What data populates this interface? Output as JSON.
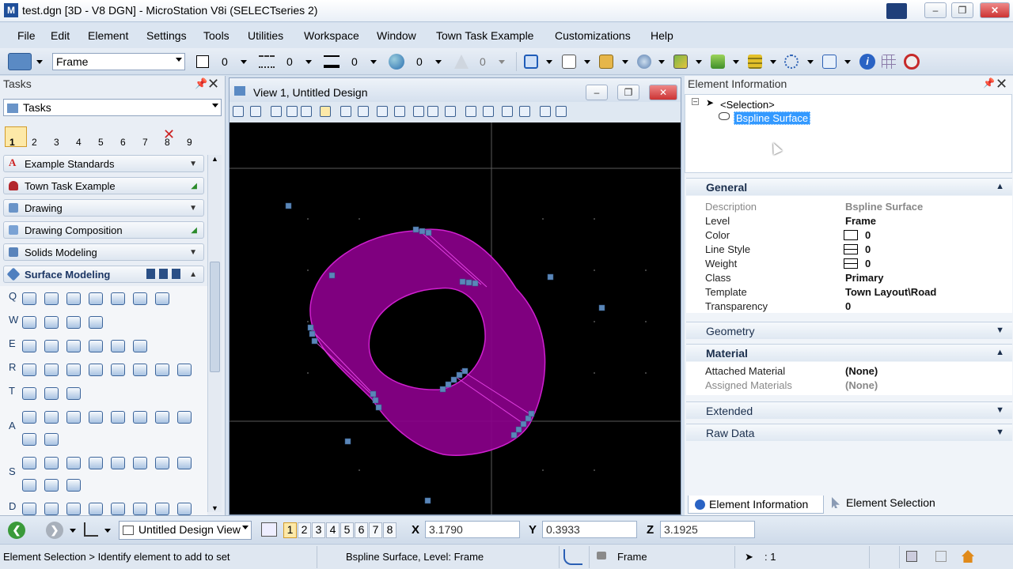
{
  "window": {
    "title": "test.dgn [3D - V8 DGN] - MicroStation V8i (SELECTseries 2)",
    "logo": "M"
  },
  "menu": [
    "File",
    "Edit",
    "Element",
    "Settings",
    "Tools",
    "Utilities",
    "Workspace",
    "Window",
    "Town Task Example",
    "Customizations",
    "Help"
  ],
  "attributes": {
    "level": "Frame",
    "color": "0",
    "style": "0",
    "weight": "0",
    "transparency": "0",
    "priority": "0"
  },
  "tasks": {
    "title": "Tasks",
    "selector": "Tasks",
    "tool_numbers": [
      "1",
      "2",
      "3",
      "4",
      "5",
      "6",
      "7",
      "8",
      "9"
    ],
    "sections": [
      {
        "label": "Example Standards"
      },
      {
        "label": "Town Task Example"
      },
      {
        "label": "Drawing"
      },
      {
        "label": "Drawing Composition"
      },
      {
        "label": "Solids Modeling"
      },
      {
        "label": "Surface Modeling"
      }
    ],
    "row_letters": [
      "Q",
      "W",
      "E",
      "R",
      "T",
      "A",
      "S",
      "D"
    ]
  },
  "view": {
    "title": "View 1, Untitled Design"
  },
  "element_info": {
    "title": "Element Information",
    "tree_root": "<Selection>",
    "tree_child": "Bspline Surface",
    "general": {
      "header": "General",
      "rows": [
        {
          "label": "Description",
          "value": "Bspline Surface",
          "gray": true
        },
        {
          "label": "Level",
          "value": "Frame"
        },
        {
          "label": "Color",
          "value": "0"
        },
        {
          "label": "Line Style",
          "value": "0"
        },
        {
          "label": "Weight",
          "value": "0"
        },
        {
          "label": "Class",
          "value": "Primary"
        },
        {
          "label": "Template",
          "value": "Town Layout\\Road"
        },
        {
          "label": "Transparency",
          "value": "0"
        }
      ]
    },
    "geometry": "Geometry",
    "material": {
      "header": "Material",
      "rows": [
        {
          "label": "Attached Material",
          "value": "(None)"
        },
        {
          "label": "Assigned Materials",
          "value": "(None)",
          "gray": true
        }
      ]
    },
    "extended": "Extended",
    "raw_data": "Raw Data",
    "tabs": [
      "Element Information",
      "Element Selection"
    ]
  },
  "nav": {
    "view_combo": "Untitled Design View",
    "view_numbers": [
      "1",
      "2",
      "3",
      "4",
      "5",
      "6",
      "7",
      "8"
    ],
    "x_label": "X",
    "x_value": "3.1790",
    "y_label": "Y",
    "y_value": "0.3933",
    "z_label": "Z",
    "z_value": "3.1925"
  },
  "status": {
    "prompt": "Element Selection > Identify element to add to set",
    "message": "Bspline Surface, Level: Frame",
    "active_level": "Frame",
    "selection_count": ": 1"
  },
  "colors": {
    "surface": "#8a008a",
    "surface_edge": "#d020d0",
    "handle": "#5a86b8",
    "selection": "#3399ff"
  }
}
